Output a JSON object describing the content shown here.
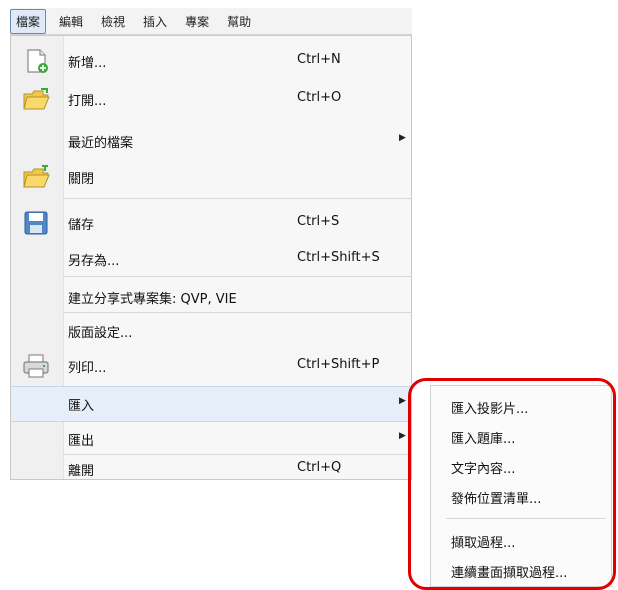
{
  "menubar": {
    "items": [
      "檔案",
      "編輯",
      "檢視",
      "插入",
      "專案",
      "幫助"
    ]
  },
  "file_menu": {
    "items": [
      {
        "label": "新增...",
        "shortcut": "Ctrl+N",
        "icon": "new-document-icon"
      },
      {
        "label": "打開...",
        "shortcut": "Ctrl+O",
        "icon": "open-folder-icon"
      },
      {
        "label": "最近的檔案",
        "shortcut": "",
        "icon": ""
      },
      {
        "label": "關閉",
        "shortcut": "",
        "icon": "close-folder-icon"
      },
      {
        "label": "儲存",
        "shortcut": "Ctrl+S",
        "icon": "save-disk-icon"
      },
      {
        "label": "另存為...",
        "shortcut": "Ctrl+Shift+S",
        "icon": ""
      },
      {
        "label": "建立分享式專案集: QVP, VIE",
        "shortcut": "",
        "icon": ""
      },
      {
        "label": "版面設定...",
        "shortcut": "",
        "icon": ""
      },
      {
        "label": "列印...",
        "shortcut": "Ctrl+Shift+P",
        "icon": "printer-icon"
      },
      {
        "label": "匯入",
        "shortcut": "",
        "icon": ""
      },
      {
        "label": "匯出",
        "shortcut": "",
        "icon": ""
      },
      {
        "label": "離開",
        "shortcut": "Ctrl+Q",
        "icon": ""
      }
    ]
  },
  "import_submenu": {
    "items": [
      "匯入投影片...",
      "匯入題庫...",
      "文字內容...",
      "發佈位置清單...",
      "擷取過程...",
      "連續畫面擷取過程..."
    ]
  },
  "colors": {
    "highlight_box": "#e00000",
    "hover_row": "#e6eef9"
  }
}
